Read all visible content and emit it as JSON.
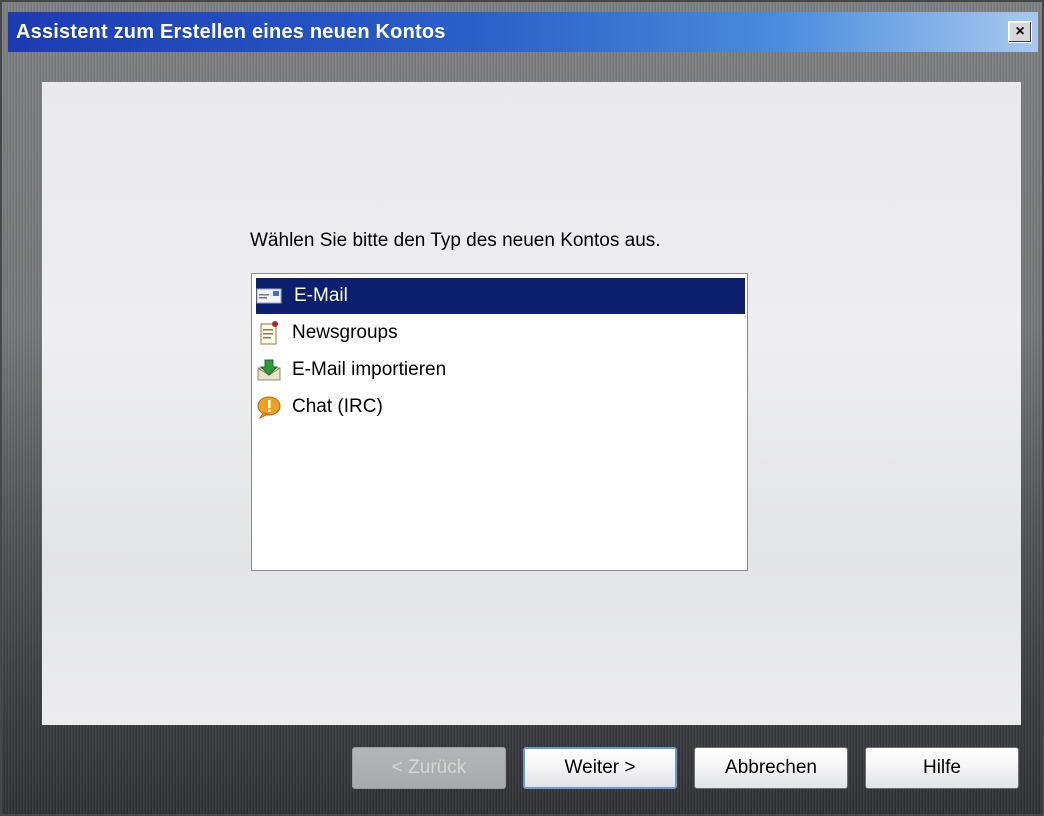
{
  "window": {
    "title": "Assistent zum Erstellen eines neuen Kontos",
    "close_label": "×"
  },
  "main": {
    "prompt": "Wählen Sie bitte den Typ des neuen Kontos aus.",
    "account_types": [
      {
        "label": "E-Mail",
        "icon": "email-icon",
        "selected": true
      },
      {
        "label": "Newsgroups",
        "icon": "newsgroups-icon",
        "selected": false
      },
      {
        "label": "E-Mail importieren",
        "icon": "import-icon",
        "selected": false
      },
      {
        "label": "Chat (IRC)",
        "icon": "chat-icon",
        "selected": false
      }
    ]
  },
  "buttons": {
    "back": "< Zurück",
    "next": "Weiter >",
    "cancel": "Abbrechen",
    "help": "Hilfe"
  },
  "colors": {
    "selection": "#0b1f6e",
    "titlebar_start": "#1c3bb3",
    "titlebar_end": "#a7c9ef"
  }
}
